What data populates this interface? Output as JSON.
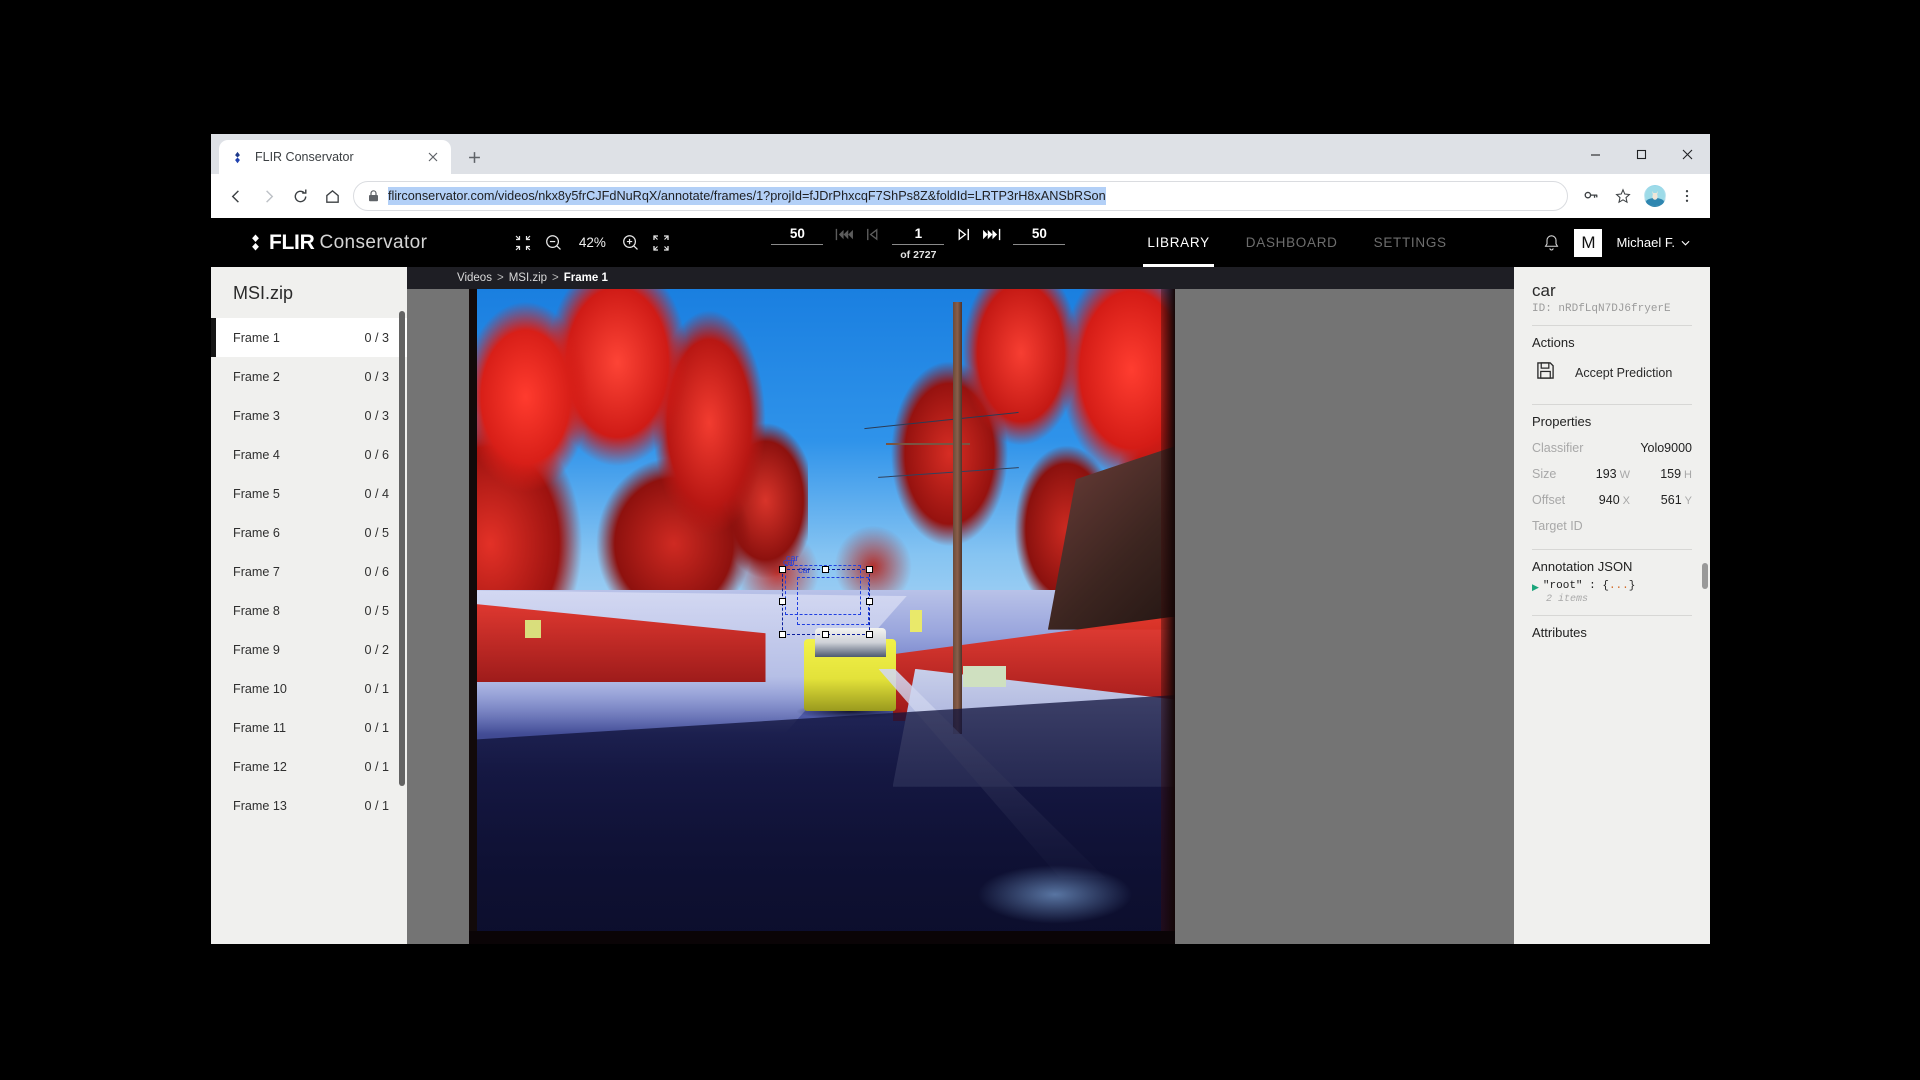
{
  "browser": {
    "tab": {
      "title": "FLIR Conservator",
      "favicon": "flir-diamond-icon",
      "close": "×"
    },
    "new_tab": "+",
    "window_controls": {
      "minimize": "–",
      "maximize": "□",
      "close": "✕"
    },
    "nav": {
      "back": "←",
      "forward": "→",
      "reload": "⟳",
      "home": "⌂"
    },
    "omnibox": {
      "url": "flirconservator.com/videos/nkx8y5frCJFdNuRqX/annotate/frames/1?projId=fJDrPhxcqF7ShPs8Z&foldId=LRTP3rH8xANSbRSon",
      "lock": "site-secure-lock-icon",
      "key_icon": "key-icon",
      "bookmark_icon": "star-icon",
      "menu_icon": "kebab-menu-icon"
    }
  },
  "app": {
    "brand": {
      "name": "FLIR",
      "product": "Conservator"
    },
    "zoom": {
      "fit_label": "fit-inward-icon",
      "out": "zoom-out-icon",
      "level": "42%",
      "in": "zoom-in-icon",
      "expand": "fullscreen-icon"
    },
    "frame_nav": {
      "step_back_value": "50",
      "skip_back": "skip-back-many-icon",
      "prev": "previous-frame-icon",
      "current_frame": "1",
      "total_label": "of 2727",
      "next": "next-frame-icon",
      "skip_forward": "skip-forward-many-icon",
      "step_forward_value": "50"
    },
    "tabs": [
      {
        "label": "LIBRARY",
        "active": true
      },
      {
        "label": "DASHBOARD",
        "active": false
      },
      {
        "label": "SETTINGS",
        "active": false
      }
    ],
    "notifications_icon": "bell-icon",
    "user": {
      "initial": "M",
      "name": "Michael F.",
      "caret": "chevron-down-icon"
    }
  },
  "sidebar": {
    "title": "MSI.zip",
    "frames": [
      {
        "name": "Frame 1",
        "count": "0 / 3",
        "selected": true
      },
      {
        "name": "Frame 2",
        "count": "0 / 3",
        "selected": false
      },
      {
        "name": "Frame 3",
        "count": "0 / 3",
        "selected": false
      },
      {
        "name": "Frame 4",
        "count": "0 / 6",
        "selected": false
      },
      {
        "name": "Frame 5",
        "count": "0 / 4",
        "selected": false
      },
      {
        "name": "Frame 6",
        "count": "0 / 5",
        "selected": false
      },
      {
        "name": "Frame 7",
        "count": "0 / 6",
        "selected": false
      },
      {
        "name": "Frame 8",
        "count": "0 / 5",
        "selected": false
      },
      {
        "name": "Frame 9",
        "count": "0 / 2",
        "selected": false
      },
      {
        "name": "Frame 10",
        "count": "0 / 1",
        "selected": false
      },
      {
        "name": "Frame 11",
        "count": "0 / 1",
        "selected": false
      },
      {
        "name": "Frame 12",
        "count": "0 / 1",
        "selected": false
      },
      {
        "name": "Frame 13",
        "count": "0 / 1",
        "selected": false
      }
    ]
  },
  "breadcrumb": {
    "root": "Videos",
    "sep1": ">",
    "folder": "MSI.zip",
    "sep2": ">",
    "current": "Frame 1"
  },
  "canvas": {
    "annotations": [
      {
        "label": "car"
      },
      {
        "label": "car"
      },
      {
        "label": "car"
      }
    ]
  },
  "inspector": {
    "title": "car",
    "id": "ID: nRDfLqN7DJ6fryerE",
    "actions_heading": "Actions",
    "accept_prediction": {
      "icon": "save-floppy-icon",
      "label": "Accept Prediction"
    },
    "properties_heading": "Properties",
    "properties": [
      {
        "key": "Classifier",
        "value": "Yolo9000",
        "unit": ""
      },
      {
        "key": "Size",
        "value1": "193",
        "unit1": "W",
        "value2": "159",
        "unit2": "H"
      },
      {
        "key": "Offset",
        "value1": "940",
        "unit1": "X",
        "value2": "561",
        "unit2": "Y"
      },
      {
        "key": "Target ID",
        "value": "",
        "unit": ""
      }
    ],
    "json_heading": "Annotation JSON",
    "json_root": "\"root\" : {",
    "json_dots": "...",
    "json_close": "}",
    "json_items": "2 items",
    "attributes_heading": "Attributes"
  },
  "colors": {
    "header_bg": "#000000",
    "panel_bg": "#f0f0ee",
    "canvas_bg": "#747474",
    "accent_selected": "#ffffff",
    "annotation_box": "#1f3fe0",
    "url_highlight": "#b3d0f7"
  }
}
